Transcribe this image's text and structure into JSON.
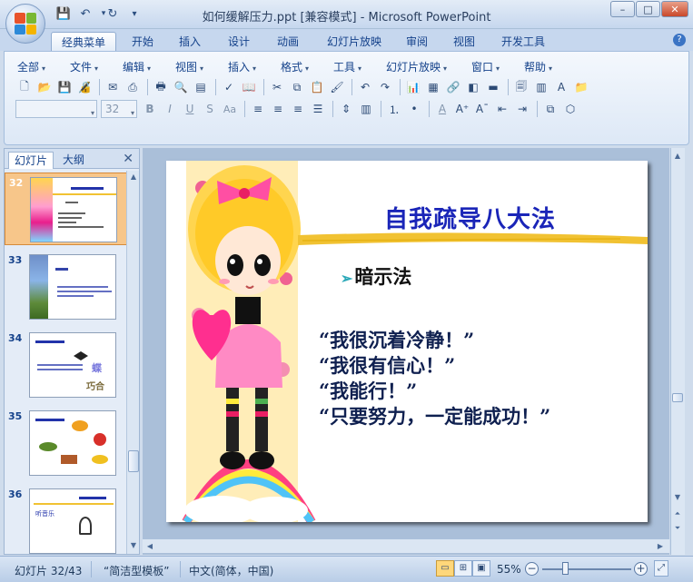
{
  "window": {
    "title": "如何缓解压力.ppt [兼容模式] - Microsoft PowerPoint",
    "controls": [
      "–",
      "□",
      "✕"
    ]
  },
  "quick_access": [
    "save-icon",
    "undo-icon",
    "redo-icon",
    "customize-icon"
  ],
  "ribbon_tabs": [
    "经典菜单",
    "开始",
    "插入",
    "设计",
    "动画",
    "幻灯片放映",
    "审阅",
    "视图",
    "开发工具"
  ],
  "active_tab": "经典菜单",
  "classic_menu": [
    "全部",
    "文件",
    "编辑",
    "视图",
    "插入",
    "格式",
    "工具",
    "幻灯片放映",
    "窗口",
    "帮助"
  ],
  "format_bar": {
    "font_name": "",
    "font_size": "32",
    "bold": "B",
    "italic": "I",
    "underline": "U",
    "strike": "S",
    "shadow": "Aa",
    "font_color": "A"
  },
  "slide_pane": {
    "tabs": [
      "幻灯片",
      "大纲"
    ],
    "close": "✕",
    "thumbnails": [
      {
        "num": "32",
        "selected": true
      },
      {
        "num": "33",
        "selected": false
      },
      {
        "num": "34",
        "selected": false
      },
      {
        "num": "35",
        "selected": false
      },
      {
        "num": "36",
        "selected": false
      }
    ],
    "thumb_text_34": "巧合",
    "thumb_text_36": "听音乐"
  },
  "slide": {
    "title": "自我疏导八大法",
    "bullet": "暗示法",
    "bullet_mark": "➢",
    "quotes": [
      "“我很沉着冷静！”",
      "“我很有信心！”",
      "“我能行！”",
      "“只要努力，一定能成功！”"
    ],
    "colors": {
      "title": "#1a25b8",
      "brush_stroke": "#f1c232",
      "quote": "#0f2050"
    }
  },
  "status": {
    "slide_counter": "幻灯片 32/43",
    "template": "“简洁型模板”",
    "language": "中文(简体，中国)",
    "zoom": "55%",
    "zoom_level_fraction": 0.25
  }
}
